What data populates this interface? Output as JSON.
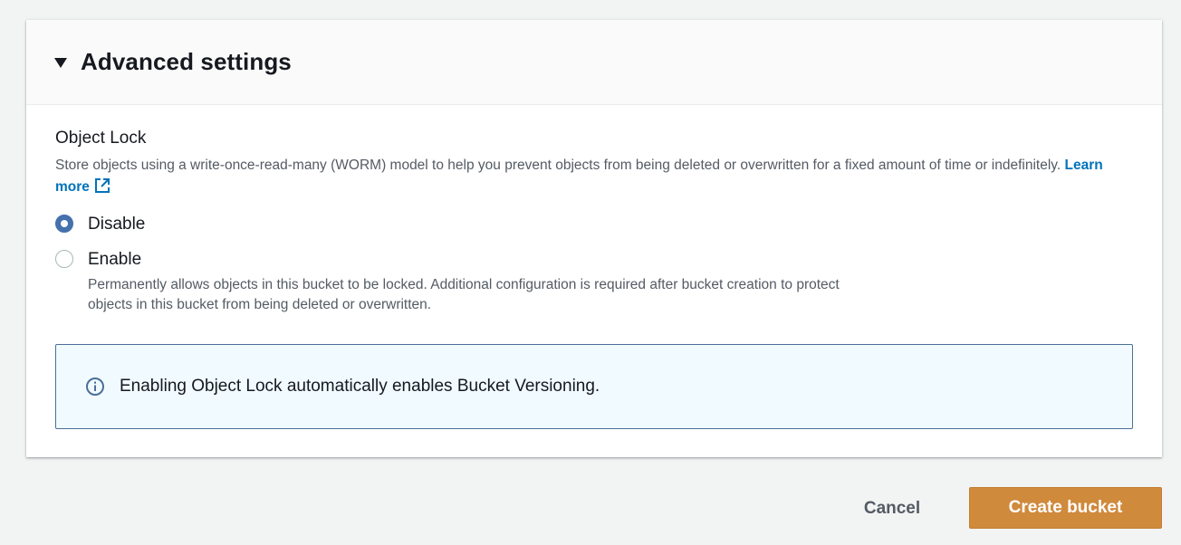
{
  "panel": {
    "title": "Advanced settings",
    "expanded": true
  },
  "object_lock": {
    "label": "Object Lock",
    "description": "Store objects using a write-once-read-many (WORM) model to help you prevent objects from being deleted or overwritten for a fixed amount of time or indefinitely.",
    "learn_more": "Learn more",
    "options": [
      {
        "label": "Disable",
        "checked": true,
        "description": ""
      },
      {
        "label": "Enable",
        "checked": false,
        "description": "Permanently allows objects in this bucket to be locked. Additional configuration is required after bucket creation to protect objects in this bucket from being deleted or overwritten."
      }
    ]
  },
  "info_box": {
    "icon": "info-icon",
    "text": "Enabling Object Lock automatically enables Bucket Versioning."
  },
  "actions": {
    "cancel_label": "Cancel",
    "create_label": "Create bucket"
  },
  "colors": {
    "primary_button": "#d08a3c",
    "link": "#0073bb",
    "radio_checked": "#4572ad",
    "info_border": "#4a6f99"
  }
}
